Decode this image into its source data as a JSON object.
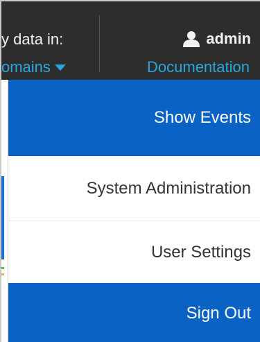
{
  "header": {
    "filter_label": "y data in:",
    "filter_value": "omains",
    "user_name": "admin",
    "documentation_label": "Documentation"
  },
  "menu": {
    "items": [
      {
        "label": "Show Events"
      },
      {
        "label": "System Administration"
      },
      {
        "label": "User Settings"
      },
      {
        "label": "Sign Out"
      }
    ]
  },
  "colors": {
    "header_bg": "#2d2d2d",
    "link_blue": "#29a8e0",
    "menu_blue": "#0a63c4"
  },
  "icons": {
    "user": "user-icon",
    "caret": "caret-down-icon"
  }
}
